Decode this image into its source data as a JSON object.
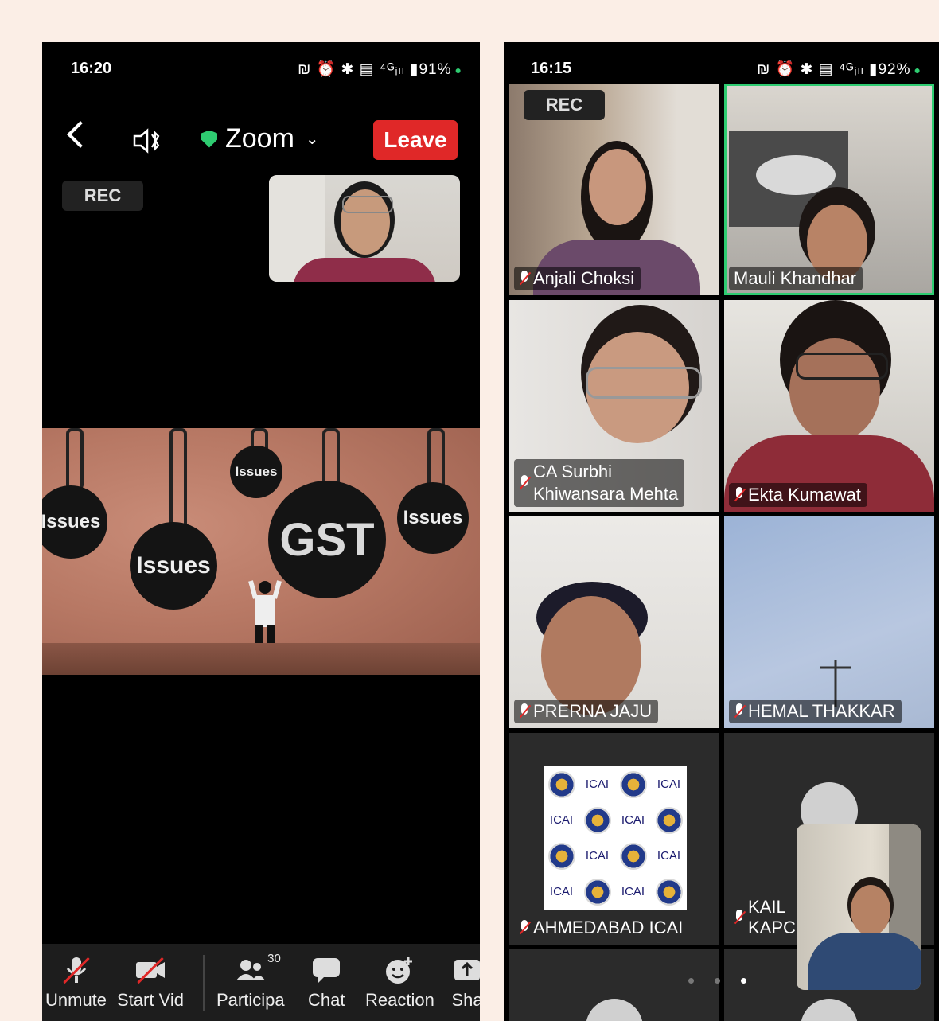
{
  "left_phone": {
    "status": {
      "time": "16:20",
      "icons": "₪ ⏰ ✱ ▤ ⁴ᴳᵢₗₗ ▮91%",
      "battery": "91%"
    },
    "header": {
      "app_title": "Zoom",
      "leave_label": "Leave",
      "rec_label": "REC"
    },
    "share": {
      "balls": [
        "Issues",
        "Issues",
        "Issues",
        "GST",
        "Issues"
      ]
    },
    "toolbar": {
      "items": [
        {
          "label": "Unmute",
          "icon": "mic-muted-icon"
        },
        {
          "label": "Start Vid",
          "icon": "video-off-icon"
        },
        {
          "label": "Participa",
          "icon": "participants-icon",
          "count": "30"
        },
        {
          "label": "Chat",
          "icon": "chat-icon"
        },
        {
          "label": "Reaction",
          "icon": "reaction-icon"
        },
        {
          "label": "Sha",
          "icon": "share-icon"
        }
      ]
    }
  },
  "right_phone": {
    "status": {
      "time": "16:15",
      "icons": "₪ ⏰ ✱ ▤ ⁴ᴳᵢₗₗ ▮92%"
    },
    "rec_label": "REC",
    "tiles": [
      {
        "name": "Anjali Choksi"
      },
      {
        "name": "Mauli Khandhar"
      },
      {
        "name_line1": "CA Surbhi",
        "name_line2": "Khiwansara Mehta"
      },
      {
        "name": "Ekta Kumawat"
      },
      {
        "name": "PRERNA JAJU"
      },
      {
        "name": "HEMAL THAKKAR"
      },
      {
        "name": "AHMEDABAD ICAI"
      },
      {
        "name_line1": "KAIL",
        "name_line2": "KAPC"
      }
    ],
    "icai_text": "ICAI"
  },
  "colors": {
    "leave_red": "#e02828",
    "active_speaker_green": "#2ecc71"
  }
}
